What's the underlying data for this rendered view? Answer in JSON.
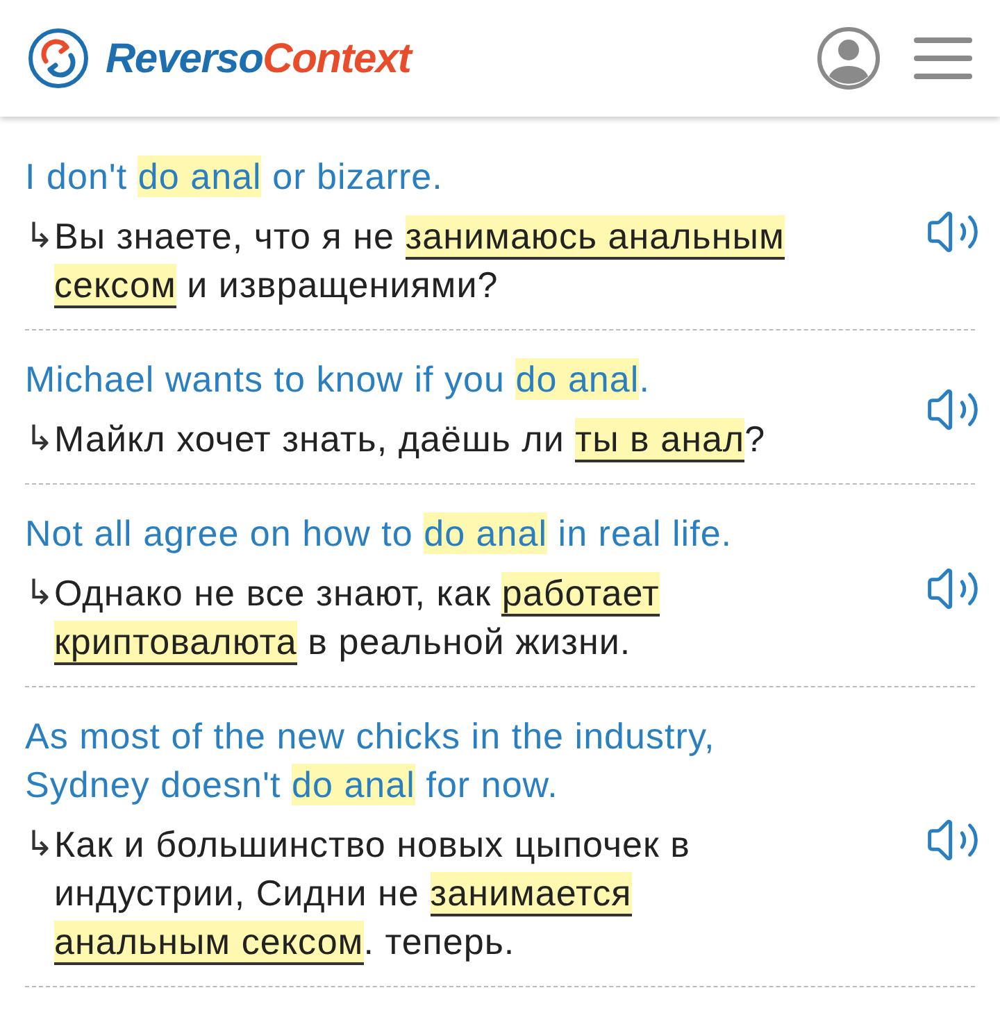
{
  "header": {
    "logo": {
      "primary": "Reverso",
      "secondary": "Context"
    }
  },
  "examples": [
    {
      "source": [
        {
          "text": "I don't ",
          "highlight": false
        },
        {
          "text": "do anal",
          "highlight": true
        },
        {
          "text": " or bizarre.",
          "highlight": false
        }
      ],
      "arrow": "↳",
      "target": [
        {
          "text": "Вы знаете, что я не ",
          "highlight": false
        },
        {
          "text": "занимаюсь анальным сексом",
          "highlight": true
        },
        {
          "text": " и извращениями?",
          "highlight": false
        }
      ]
    },
    {
      "source": [
        {
          "text": "Michael wants to know if you ",
          "highlight": false
        },
        {
          "text": "do anal",
          "highlight": true
        },
        {
          "text": ".",
          "highlight": false
        }
      ],
      "arrow": "↳",
      "target": [
        {
          "text": "Майкл хочет знать, даёшь ли ",
          "highlight": false
        },
        {
          "text": "ты в анал",
          "highlight": true
        },
        {
          "text": "?",
          "highlight": false
        }
      ]
    },
    {
      "source": [
        {
          "text": "Not all agree on how to ",
          "highlight": false
        },
        {
          "text": "do anal",
          "highlight": true
        },
        {
          "text": " in real life.",
          "highlight": false
        }
      ],
      "arrow": "↳",
      "target": [
        {
          "text": "Однако не все знают, как ",
          "highlight": false
        },
        {
          "text": "работает криптовалюта",
          "highlight": true
        },
        {
          "text": " в реальной жизни.",
          "highlight": false
        }
      ]
    },
    {
      "source": [
        {
          "text": "As most of the new chicks in the industry, Sydney doesn't ",
          "highlight": false
        },
        {
          "text": "do anal",
          "highlight": true
        },
        {
          "text": " for now.",
          "highlight": false
        }
      ],
      "arrow": "↳",
      "target": [
        {
          "text": "Как и большинство новых цыпочек в индустрии, Сидни не ",
          "highlight": false
        },
        {
          "text": "занимается анальным сексом",
          "highlight": true
        },
        {
          "text": ". теперь.",
          "highlight": false
        }
      ]
    }
  ]
}
